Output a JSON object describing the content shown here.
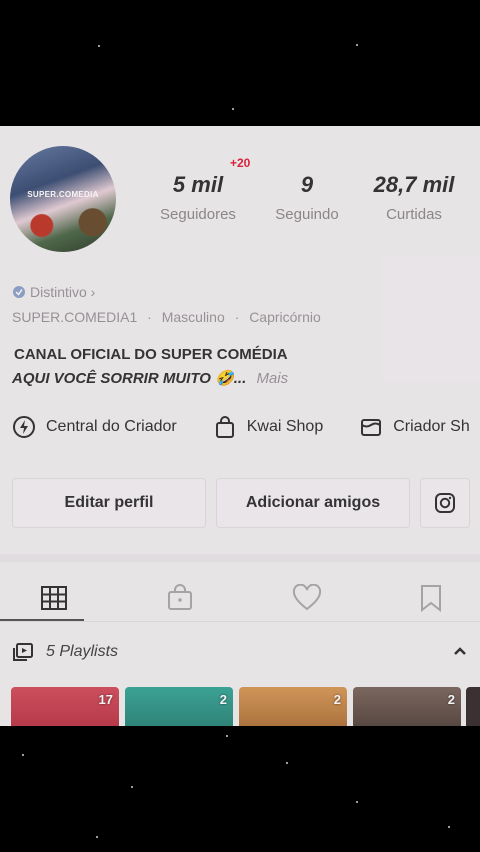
{
  "profile": {
    "avatar_text": "SUPER.COMEDIA",
    "stats": [
      {
        "value": "5 mil",
        "label": "Seguidores"
      },
      {
        "value": "9",
        "label": "Seguindo"
      },
      {
        "value": "28,7 mil",
        "label": "Curtidas"
      }
    ],
    "followers_delta": "+20",
    "badge_label": "Distintivo ›",
    "meta": {
      "username": "SUPER.COMEDIA1",
      "gender": "Masculino",
      "sign": "Capricórnio",
      "separator": "·"
    },
    "bio_line1": "CANAL OFICIAL DO SUPER COMÉDIA",
    "bio_line2": "AQUI VOCÊ SORRIR MUITO 🤣...",
    "bio_more": "Mais"
  },
  "links": [
    {
      "label": "Central do Criador",
      "icon": "lightning-circle-icon"
    },
    {
      "label": "Kwai Shop",
      "icon": "shopping-bag-icon"
    },
    {
      "label": "Criador Sh",
      "icon": "creator-shop-icon"
    }
  ],
  "actions": {
    "edit_profile": "Editar perfil",
    "add_friends": "Adicionar amigos",
    "instagram_icon": "instagram-icon"
  },
  "tabs": [
    {
      "icon": "grid-icon",
      "active": true
    },
    {
      "icon": "locked-bag-icon",
      "active": false
    },
    {
      "icon": "heart-icon",
      "active": false
    },
    {
      "icon": "bookmark-icon",
      "active": false
    }
  ],
  "playlists": {
    "label": "5 Playlists",
    "thumbs": [
      {
        "count": "17",
        "color": "#c94150"
      },
      {
        "count": "2",
        "color": "#2f9a8a"
      },
      {
        "count": "2",
        "color": "#c98a4a"
      },
      {
        "count": "2",
        "color": "#6b5a52"
      }
    ]
  },
  "colors": {
    "panel_bg": "#f1eef0",
    "accent_red": "#e0223a",
    "background": "#000000"
  }
}
